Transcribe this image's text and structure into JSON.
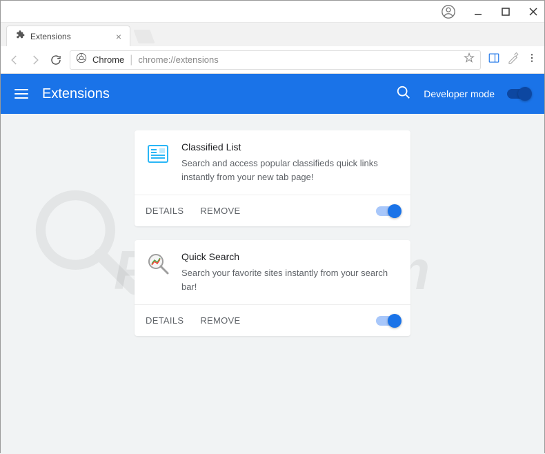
{
  "window": {
    "tab_title": "Extensions"
  },
  "addressbar": {
    "scheme_label": "Chrome",
    "url": "chrome://extensions"
  },
  "header": {
    "title": "Extensions",
    "dev_mode_label": "Developer mode"
  },
  "extensions": [
    {
      "name": "Classified List",
      "description": "Search and access popular classifieds quick links instantly from your new tab page!",
      "details_label": "DETAILS",
      "remove_label": "REMOVE",
      "enabled": true,
      "icon": "newspaper"
    },
    {
      "name": "Quick Search",
      "description": "Search your favorite sites instantly from your search bar!",
      "details_label": "DETAILS",
      "remove_label": "REMOVE",
      "enabled": true,
      "icon": "magnifier-chart"
    }
  ],
  "watermark": "PCrisk.com"
}
